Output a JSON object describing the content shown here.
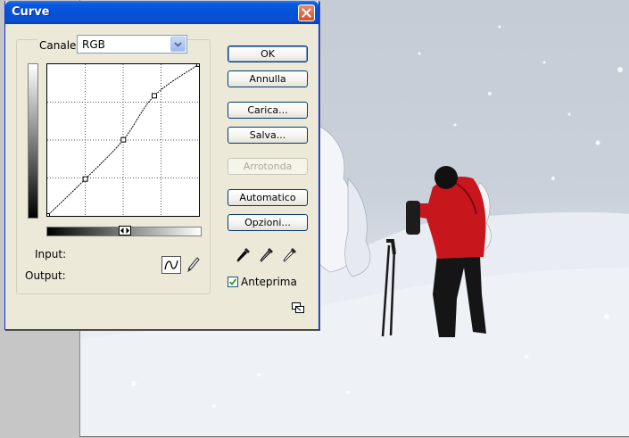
{
  "dialog": {
    "title": "Curve",
    "channel_label": "Canale:",
    "channel_value": "RGB",
    "input_label": "Input:",
    "output_label": "Output:",
    "buttons": {
      "ok": "OK",
      "cancel": "Annulla",
      "load": "Carica...",
      "save": "Salva...",
      "smooth": "Arrotonda",
      "auto": "Automatico",
      "options": "Opzioni..."
    },
    "preview_label": "Anteprima",
    "preview_checked": true
  },
  "icons": {
    "close": "close-icon",
    "dropdown": "chevron-down-icon",
    "curve_tool": "curve-tool-icon",
    "pencil_tool": "pencil-icon",
    "black_point": "eyedropper-black-icon",
    "gray_point": "eyedropper-gray-icon",
    "white_point": "eyedropper-white-icon",
    "expand": "resize-toggle-icon"
  },
  "curve": {
    "points": [
      [
        0,
        0
      ],
      [
        64,
        62
      ],
      [
        128,
        128
      ],
      [
        180,
        202
      ],
      [
        255,
        255
      ]
    ]
  },
  "colors": {
    "titlebar": "#0551d8",
    "dialog_bg": "#ece9d8",
    "close": "#d2512c",
    "jacket": "#c8161d"
  }
}
